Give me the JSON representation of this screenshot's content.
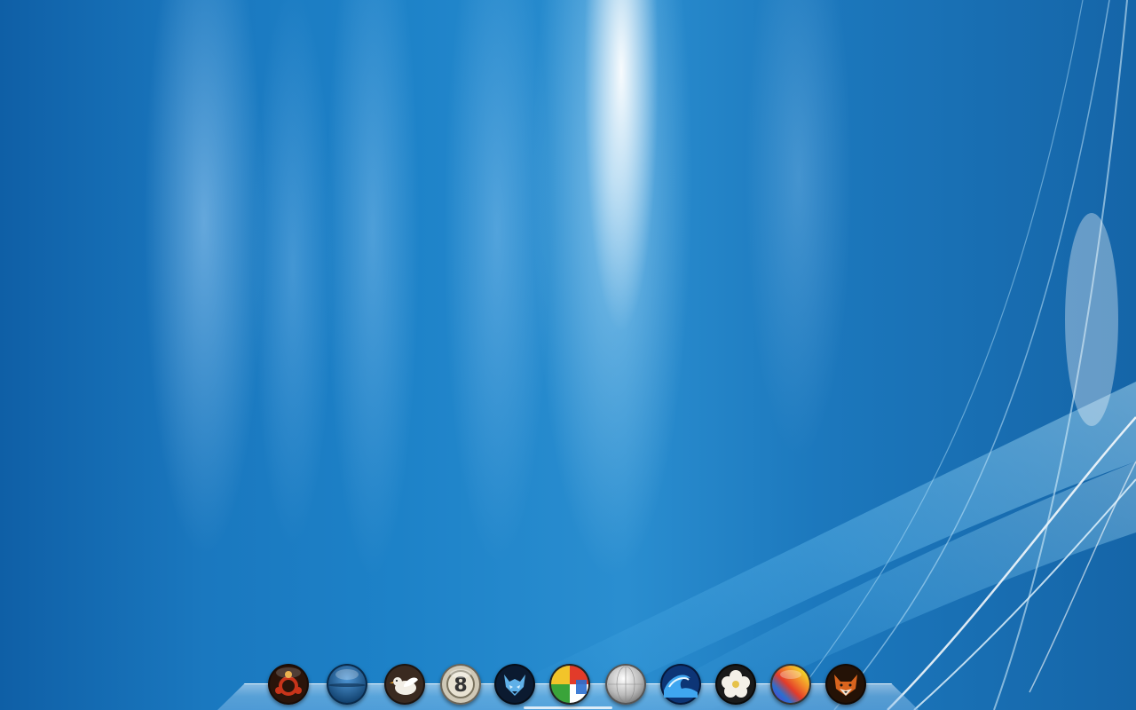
{
  "desktop": {
    "wallpaper": "blue-aurora-wallpaper"
  },
  "dock": {
    "items": [
      {
        "icon": "ubuntu-logo-icon"
      },
      {
        "icon": "blue-orb-icon"
      },
      {
        "icon": "dove-icon"
      },
      {
        "icon": "eight-ball-icon"
      },
      {
        "icon": "wolf-icon"
      },
      {
        "icon": "color-chart-icon"
      },
      {
        "icon": "silver-sphere-icon"
      },
      {
        "icon": "wave-icon"
      },
      {
        "icon": "flower-icon"
      },
      {
        "icon": "rainbow-icon"
      },
      {
        "icon": "fox-icon"
      }
    ]
  },
  "colors": {
    "background": "#1d82c8",
    "dock_glass": "#a0cdf0"
  }
}
